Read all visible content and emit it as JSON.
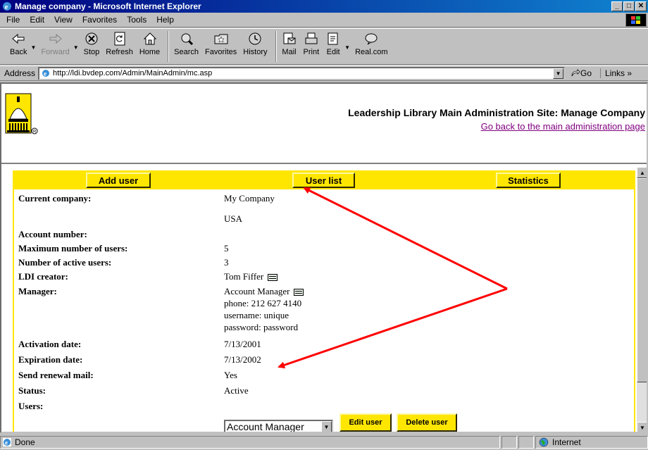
{
  "window": {
    "title": "Manage company - Microsoft Internet Explorer",
    "minimize": "_",
    "maximize": "□",
    "close": "✕"
  },
  "menu": [
    "File",
    "Edit",
    "View",
    "Favorites",
    "Tools",
    "Help"
  ],
  "toolbar": {
    "back": "Back",
    "forward": "Forward",
    "stop": "Stop",
    "refresh": "Refresh",
    "home": "Home",
    "search": "Search",
    "favorites": "Favorites",
    "history": "History",
    "mail": "Mail",
    "print": "Print",
    "edit": "Edit",
    "real": "Real.com"
  },
  "address": {
    "label": "Address",
    "url": "http://ldi.bvdep.com/Admin/MainAdmin/mc.asp",
    "go": "Go",
    "links": "Links »"
  },
  "header": {
    "site_title": "Leadership Library Main Administration Site: Manage Company",
    "back_link": "Go back to the main administration page"
  },
  "nav": {
    "add_user": "Add user",
    "user_list": "User list",
    "statistics": "Statistics"
  },
  "company": {
    "current_company_label": "Current company:",
    "current_company": "My Company",
    "country": "USA",
    "account_number_label": "Account number:",
    "max_users_label": "Maximum number of users:",
    "max_users": "5",
    "active_users_label": "Number of active users:",
    "active_users": "3",
    "ldi_creator_label": "LDI creator:",
    "ldi_creator": "Tom Fiffer",
    "manager_label": "Manager:",
    "manager_name": "Account Manager",
    "manager_phone": "phone: 212 627 4140",
    "manager_username": "username: unique",
    "manager_password": "password: password",
    "activation_label": "Activation date:",
    "activation": "7/13/2001",
    "expiration_label": "Expiration date:",
    "expiration": "7/13/2002",
    "renewal_label": "Send renewal mail:",
    "renewal": "Yes",
    "status_label": "Status:",
    "status": "Active",
    "users_label": "Users:",
    "users_selected": "Account Manager",
    "edit_user": "Edit user",
    "delete_user": "Delete user"
  },
  "status": {
    "left": "Done",
    "zone": "Internet"
  },
  "colors": {
    "accent_yellow": "#ffe600",
    "arrow_red": "#ff0000",
    "visited_link": "#800080",
    "title_bar": "#000080"
  }
}
